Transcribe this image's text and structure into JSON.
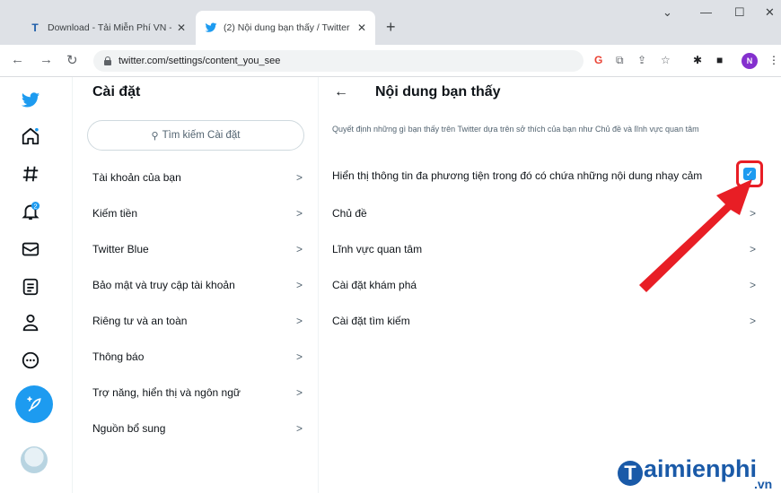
{
  "browser": {
    "tabs": [
      {
        "title": "Download - Tải Miễn Phí VN - Ph",
        "favicon": "T"
      },
      {
        "title": "(2) Nội dung bạn thấy / Twitter",
        "favicon": "bird"
      }
    ],
    "url": "twitter.com/settings/content_you_see",
    "profile_initial": "N"
  },
  "rail": {
    "notification_count": "2"
  },
  "settings": {
    "title": "Cài đặt",
    "search_placeholder": "Tìm kiếm Cài đặt",
    "items": [
      {
        "label": "Tài khoản của bạn"
      },
      {
        "label": "Kiếm tiền"
      },
      {
        "label": "Twitter Blue"
      },
      {
        "label": "Bảo mật và truy cập tài khoản"
      },
      {
        "label": "Riêng tư và an toàn"
      },
      {
        "label": "Thông báo"
      },
      {
        "label": "Trợ năng, hiển thị và ngôn ngữ"
      },
      {
        "label": "Nguồn bổ sung"
      }
    ]
  },
  "content": {
    "title": "Nội dung bạn thấy",
    "description": "Quyết định những gì bạn thấy trên Twitter dựa trên sở thích của bạn như Chủ đề và lĩnh vực quan tâm",
    "sensitive_media_label": "Hiển thị thông tin đa phương tiện trong đó có chứa những nội dung nhạy cảm",
    "sensitive_media_checked": true,
    "rows": [
      {
        "label": "Chủ đề"
      },
      {
        "label": "Lĩnh vực quan tâm"
      },
      {
        "label": "Cài đặt khám phá"
      },
      {
        "label": "Cài đặt tìm kiếm"
      }
    ]
  },
  "watermark": {
    "logo_letter": "T",
    "text": "aimienphi",
    "suffix": ".vn"
  },
  "colors": {
    "twitter_blue": "#1d9bf0",
    "annotation_red": "#e81e25"
  }
}
